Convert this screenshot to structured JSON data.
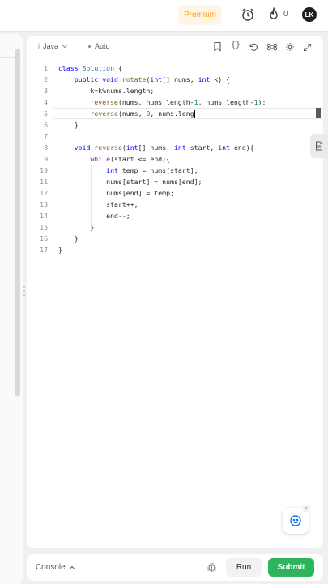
{
  "header": {
    "premium_label": "Premium",
    "streak_count": "0",
    "avatar_initials": "LK"
  },
  "editor": {
    "language": "Java",
    "mode": "Auto",
    "lines": [
      {
        "n": "1",
        "text": "class Solution {"
      },
      {
        "n": "2",
        "text": "    public void rotate(int[] nums, int k) {"
      },
      {
        "n": "3",
        "text": "        k=k%nums.length;"
      },
      {
        "n": "4",
        "text": "        reverse(nums, nums.length-1, nums.length-1);"
      },
      {
        "n": "5",
        "text": "        reverse(nums, 0, nums.leng"
      },
      {
        "n": "6",
        "text": "    }"
      },
      {
        "n": "7",
        "text": ""
      },
      {
        "n": "8",
        "text": "    void reverse(int[] nums, int start, int end){"
      },
      {
        "n": "9",
        "text": "        while(start <= end){"
      },
      {
        "n": "10",
        "text": "            int temp = nums[start];"
      },
      {
        "n": "11",
        "text": "            nums[start] = nums[end];"
      },
      {
        "n": "12",
        "text": "            nums[end] = temp;"
      },
      {
        "n": "13",
        "text": "            start++;"
      },
      {
        "n": "14",
        "text": "            end--;"
      },
      {
        "n": "15",
        "text": "        }"
      },
      {
        "n": "16",
        "text": "    }"
      },
      {
        "n": "17",
        "text": "}"
      }
    ]
  },
  "footer": {
    "console_label": "Console",
    "run_label": "Run",
    "submit_label": "Submit"
  },
  "colors": {
    "accent_premium": "#ffa116",
    "submit_green": "#2db55d"
  },
  "icons": [
    "alarm-icon",
    "fire-icon",
    "bookmark-icon",
    "braces-icon",
    "reset-icon",
    "command-icon",
    "settings-icon",
    "expand-icon",
    "document-icon",
    "chat-icon",
    "bug-icon",
    "chevron-up-icon",
    "chevron-down-icon"
  ]
}
